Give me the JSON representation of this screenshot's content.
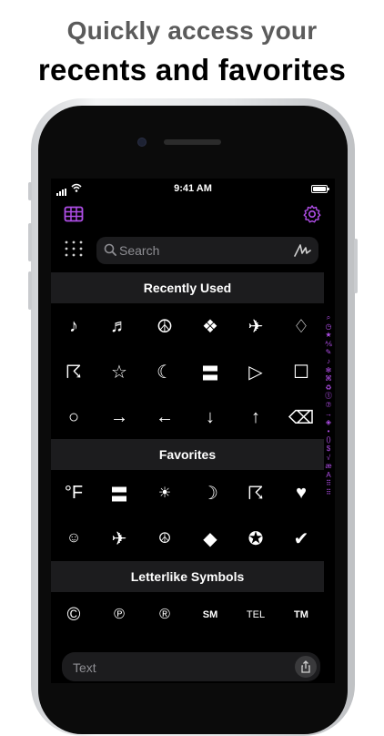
{
  "headline": {
    "line1": "Quickly access your",
    "line2": "recents and favorites"
  },
  "status": {
    "time": "9:41 AM"
  },
  "search": {
    "placeholder": "Search"
  },
  "sections": [
    {
      "title": "Recently Used",
      "symbols": [
        "♪",
        "♬",
        "☮",
        "❖",
        "✈",
        "♢",
        "☈",
        "☆",
        "☾",
        "〓",
        "▷",
        "☐",
        "○",
        "→",
        "←",
        "↓",
        "↑",
        "⌫"
      ]
    },
    {
      "title": "Favorites",
      "symbols": [
        "°F",
        "〓",
        "☀",
        "☽",
        "☈",
        "♥",
        "☺",
        "✈",
        "☮",
        "◆",
        "✪",
        "✔"
      ]
    },
    {
      "title": "Letterlike Symbols",
      "symbols": [
        "©",
        "℗",
        "®",
        "SM",
        "TEL",
        "TM"
      ]
    }
  ],
  "index": [
    "⌕",
    "◷",
    "★",
    "⅍",
    "✎",
    "♪",
    "✻",
    "⌘",
    "♻",
    "⓵",
    "⑦",
    "→",
    "◈",
    "•",
    "()",
    "$",
    "√",
    "æ",
    "A",
    "⠿",
    "⠿"
  ],
  "text_field": {
    "placeholder": "Text"
  },
  "colors": {
    "accent": "#b04ee8",
    "background": "#000000",
    "section": "#1c1c1e"
  }
}
